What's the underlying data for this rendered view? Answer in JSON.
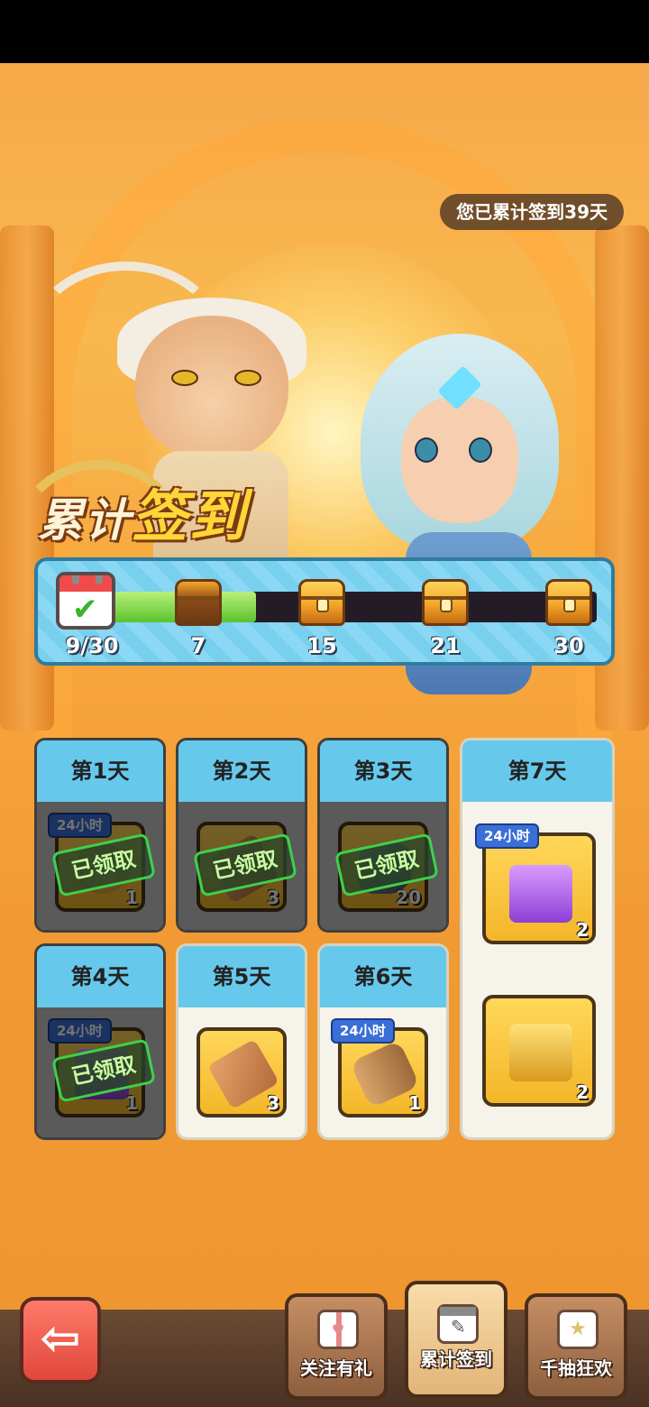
{
  "header": {
    "total_signin_text": "您已累计签到39天",
    "title_part1": "累计",
    "title_part2": "签到"
  },
  "progress": {
    "current_text": "9/30",
    "current": 9,
    "max": 30,
    "milestones": [
      {
        "label": "7",
        "state": "opened"
      },
      {
        "label": "15",
        "state": "locked"
      },
      {
        "label": "21",
        "state": "locked"
      },
      {
        "label": "30",
        "state": "locked"
      }
    ]
  },
  "days": [
    {
      "label": "第1天",
      "state": "claimed",
      "timer": "24小时",
      "qty": "1",
      "item_icon": "gold-coin-icon",
      "stamp": "已领取"
    },
    {
      "label": "第2天",
      "state": "claimed",
      "timer": "",
      "qty": "3",
      "item_icon": "scroll-icon",
      "stamp": "已领取"
    },
    {
      "label": "第3天",
      "state": "claimed",
      "timer": "",
      "qty": "20",
      "item_icon": "ore-icon",
      "stamp": "已领取"
    },
    {
      "label": "第4天",
      "state": "claimed",
      "timer": "24小时",
      "qty": "1",
      "item_icon": "gem-icon",
      "stamp": "已领取"
    },
    {
      "label": "第5天",
      "state": "open",
      "timer": "",
      "qty": "3",
      "item_icon": "scroll-icon"
    },
    {
      "label": "第6天",
      "state": "open",
      "timer": "24小时",
      "qty": "1",
      "item_icon": "wood-icon"
    },
    {
      "label": "第7天",
      "state": "open",
      "items": [
        {
          "timer": "24小时",
          "qty": "2",
          "item_icon": "gem-chest-icon"
        },
        {
          "timer": "",
          "qty": "2",
          "item_icon": "gold-card-icon"
        }
      ]
    }
  ],
  "nav": {
    "tabs": [
      {
        "label": "关注有礼",
        "icon": "gift-icon"
      },
      {
        "label": "累计签到",
        "icon": "calendar-icon",
        "active": true
      },
      {
        "label": "千抽狂欢",
        "icon": "star-gift-icon"
      }
    ],
    "back_icon": "arrow-left-icon"
  },
  "colors": {
    "background": "#f6a53c",
    "accent_blue": "#66c9ec",
    "progress_green": "#5bc22d",
    "claimed_stamp": "#3fd04a"
  }
}
